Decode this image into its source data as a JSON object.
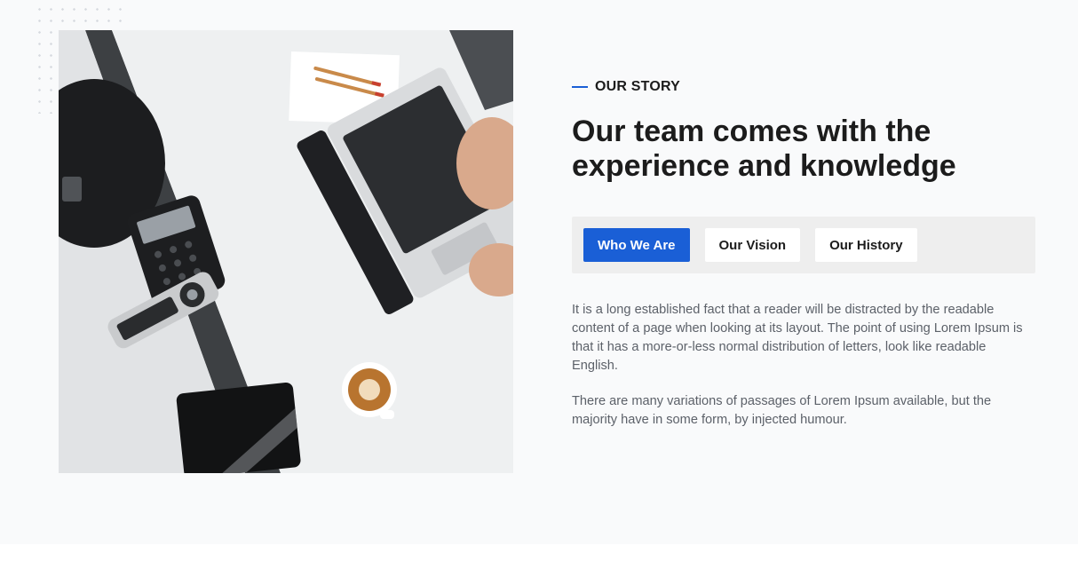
{
  "section": {
    "eyebrow": "OUR STORY",
    "title": "Our team comes with the experience and knowledge"
  },
  "tabs": [
    {
      "label": "Who We Are",
      "active": true
    },
    {
      "label": "Our Vision",
      "active": false
    },
    {
      "label": "Our History",
      "active": false
    }
  ],
  "paragraphs": [
    "It is a long established fact that a reader will be distracted by the readable content of a page when looking at its layout. The point of using Lorem Ipsum is that it has a more-or-less normal distribution of letters, look like readable English.",
    "There are many variations of passages of Lorem Ipsum available, but the majority have in some form, by injected humour."
  ],
  "colors": {
    "accent": "#1a5fd6",
    "background": "#f9fafb",
    "tab_bar": "#eeeeee",
    "body_text": "#5c6169"
  },
  "image": {
    "subject": "office-desk-photo"
  }
}
